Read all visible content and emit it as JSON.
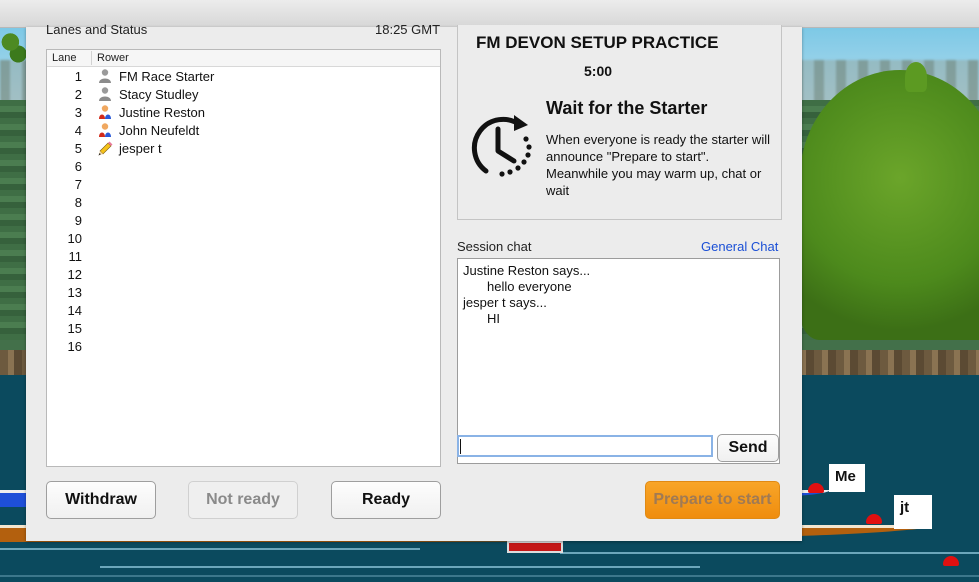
{
  "window": {
    "section_title": "Lanes and Status",
    "clock": "18:25 GMT"
  },
  "lanes": {
    "headers": {
      "lane": "Lane",
      "rower": "Rower"
    },
    "rows": [
      {
        "lane": "1",
        "rower": "FM Race  Starter",
        "icon": "person-gray-icon"
      },
      {
        "lane": "2",
        "rower": "Stacy Studley",
        "icon": "person-gray-icon"
      },
      {
        "lane": "3",
        "rower": "Justine Reston",
        "icon": "person-color-icon"
      },
      {
        "lane": "4",
        "rower": "John Neufeldt",
        "icon": "person-color-icon"
      },
      {
        "lane": "5",
        "rower": "jesper t",
        "icon": "pencil-icon"
      },
      {
        "lane": "6",
        "rower": "",
        "icon": ""
      },
      {
        "lane": "7",
        "rower": "",
        "icon": ""
      },
      {
        "lane": "8",
        "rower": "",
        "icon": ""
      },
      {
        "lane": "9",
        "rower": "",
        "icon": ""
      },
      {
        "lane": "10",
        "rower": "",
        "icon": ""
      },
      {
        "lane": "11",
        "rower": "",
        "icon": ""
      },
      {
        "lane": "12",
        "rower": "",
        "icon": ""
      },
      {
        "lane": "13",
        "rower": "",
        "icon": ""
      },
      {
        "lane": "14",
        "rower": "",
        "icon": ""
      },
      {
        "lane": "15",
        "rower": "",
        "icon": ""
      },
      {
        "lane": "16",
        "rower": "",
        "icon": ""
      }
    ]
  },
  "buttons": {
    "withdraw": "Withdraw",
    "not_ready": "Not ready",
    "ready": "Ready",
    "send": "Send",
    "prepare": "Prepare to start"
  },
  "session": {
    "title": "FM DEVON SETUP PRACTICE",
    "countdown": "5:00",
    "status_title": "Wait for the Starter",
    "status_text": "When everyone is ready the starter will announce \"Prepare to start\". Meanwhile you may warm up, chat or wait",
    "status_icon": "clock-countdown-icon"
  },
  "chat": {
    "label": "Session chat",
    "general_link": "General Chat",
    "messages": [
      {
        "author": "Justine Reston says...",
        "text": "hello everyone"
      },
      {
        "author": "jesper t says...",
        "text": "HI"
      }
    ],
    "input_value": "",
    "input_placeholder": ""
  },
  "scene": {
    "boat_labels": [
      "Me",
      "jt"
    ]
  },
  "colors": {
    "accent_orange": "#f39a1c",
    "link_blue": "#1a4fd6",
    "boat_blue": "#1e4fd8",
    "boat_brown": "#b3600e"
  }
}
